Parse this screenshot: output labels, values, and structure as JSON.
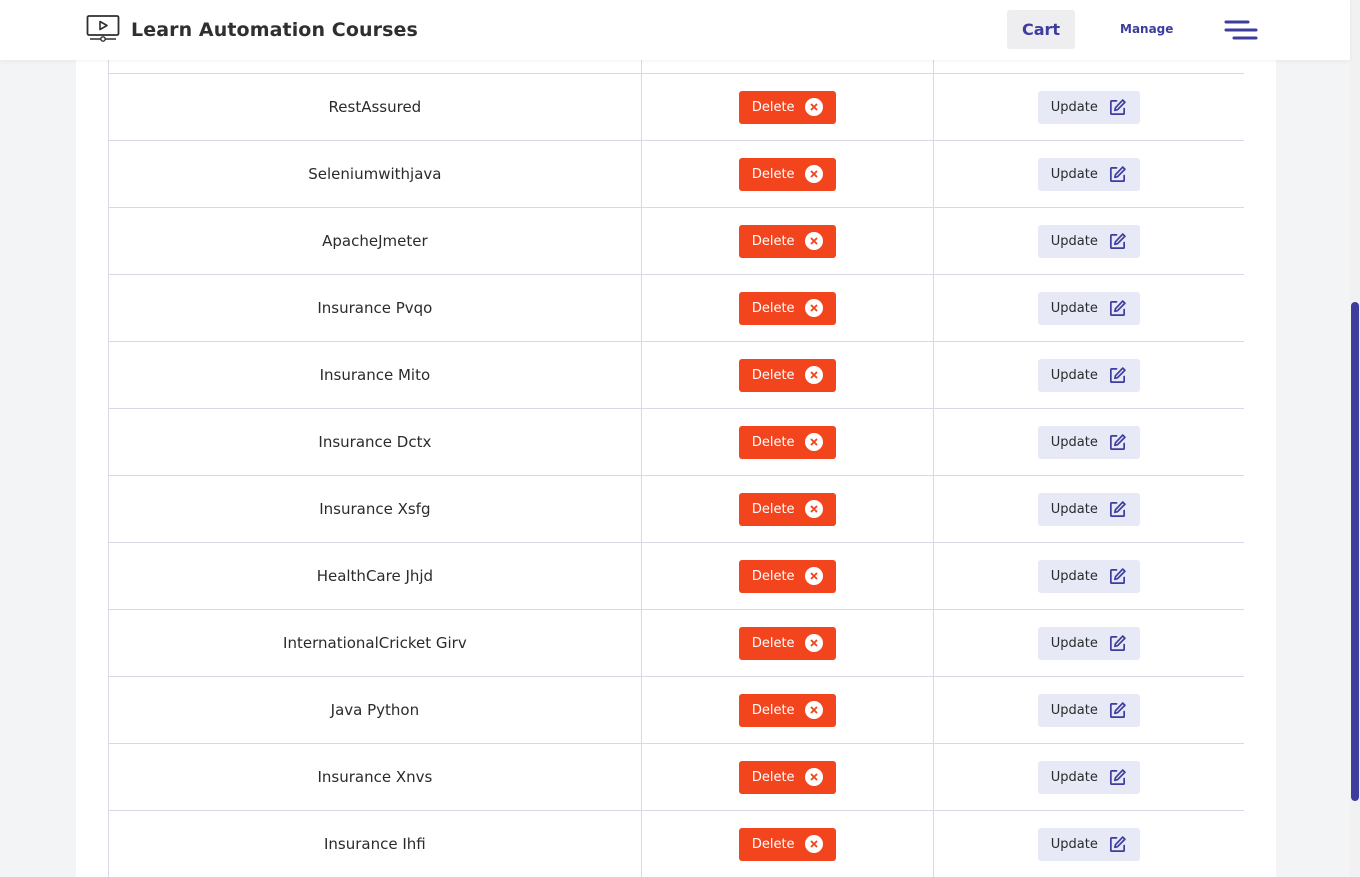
{
  "header": {
    "brand_title": "Learn Automation Courses",
    "cart_label": "Cart",
    "manage_label": "Manage"
  },
  "table": {
    "delete_label": "Delete",
    "update_label": "Update",
    "rows": [
      {
        "name": ""
      },
      {
        "name": "RestAssured"
      },
      {
        "name": "Seleniumwithjava"
      },
      {
        "name": "ApacheJmeter"
      },
      {
        "name": "Insurance Pvqo"
      },
      {
        "name": "Insurance Mito"
      },
      {
        "name": "Insurance Dctx"
      },
      {
        "name": "Insurance Xsfg"
      },
      {
        "name": "HealthCare Jhjd"
      },
      {
        "name": "InternationalCricket Girv"
      },
      {
        "name": "Java Python"
      },
      {
        "name": "Insurance Xnvs"
      },
      {
        "name": "Insurance Ihfi"
      }
    ]
  },
  "colors": {
    "accent": "#3d3d9e",
    "delete_bg": "#f2441d",
    "update_bg": "#e7e9f7"
  },
  "icons": {
    "brand": "video-course-icon",
    "delete": "close-circle-icon",
    "update": "edit-icon",
    "menu": "hamburger-menu-icon"
  }
}
